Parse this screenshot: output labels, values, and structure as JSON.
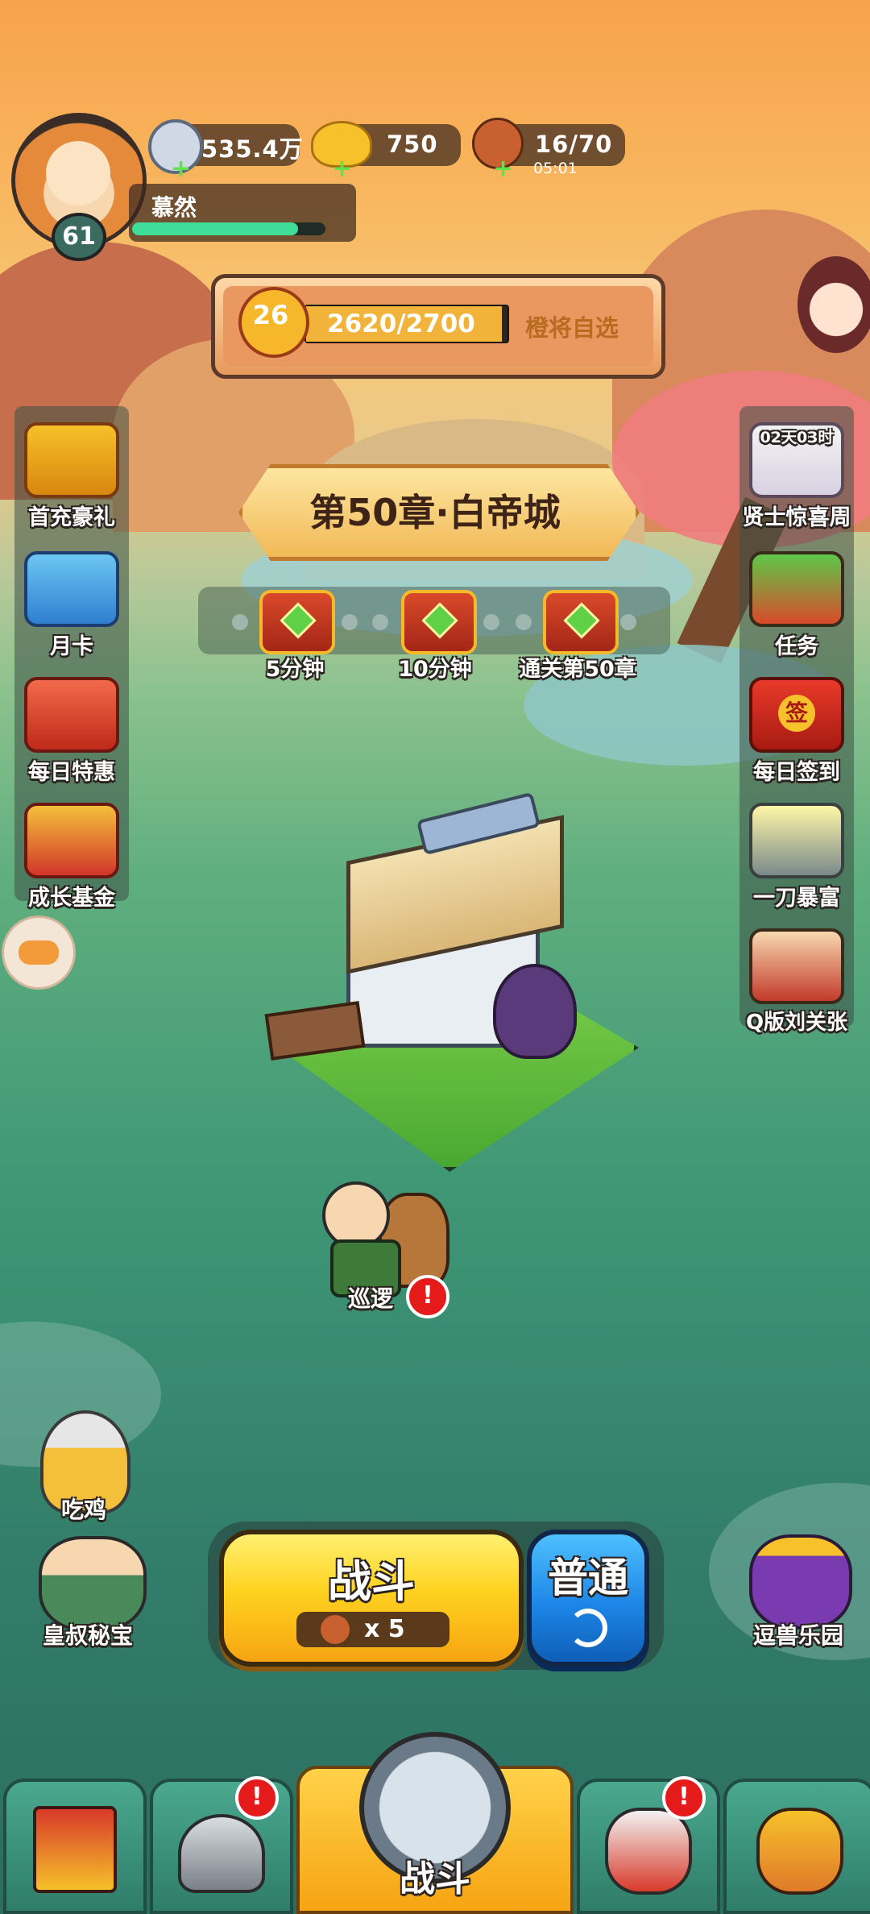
{
  "player": {
    "name": "慕然",
    "level": "61",
    "xp_fraction": 0.86
  },
  "resources": {
    "silver": "535.4万",
    "gold": "750",
    "stamina": "16/70",
    "stamina_timer": "05:01"
  },
  "rank_bar": {
    "level": "26",
    "progress": "2620/2700",
    "progress_fraction": 0.97,
    "button": "橙将自选"
  },
  "chapter": {
    "title": "第50章·白帝城"
  },
  "chest_rewards": [
    {
      "label": "5分钟"
    },
    {
      "label": "10分钟"
    },
    {
      "label": "通关第50章"
    }
  ],
  "left_menu": [
    {
      "label": "首充豪礼",
      "icon": "treasure-chest-icon"
    },
    {
      "label": "月卡",
      "icon": "calendar-icon"
    },
    {
      "label": "每日特惠",
      "icon": "gift-bag-icon"
    },
    {
      "label": "成长基金",
      "icon": "money-god-icon"
    }
  ],
  "right_menu": [
    {
      "label": "贤士惊喜周",
      "timer": "02天03时",
      "icon": "sage-girl-icon"
    },
    {
      "label": "任务",
      "icon": "scroll-icon"
    },
    {
      "label": "每日签到",
      "stamp": "签",
      "icon": "red-envelope-icon"
    },
    {
      "label": "一刀暴富",
      "icon": "sword-strike-icon"
    },
    {
      "label": "Q版刘关张",
      "icon": "three-heroes-icon"
    }
  ],
  "patrol": {
    "label": "巡逻",
    "alert": "!"
  },
  "left_bottom": [
    {
      "label": "吃鸡",
      "icon": "sunglasses-hero-icon"
    },
    {
      "label": "皇叔秘宝",
      "icon": "sleeping-scholar-icon"
    }
  ],
  "right_bottom": {
    "label": "逗兽乐园",
    "icon": "purple-beast-icon"
  },
  "battle": {
    "label": "战斗",
    "cost": "x 5"
  },
  "mode": {
    "label": "普通",
    "icon": "refresh-icon"
  },
  "bottom_nav": [
    {
      "name": "city",
      "icon": "city-gate-icon",
      "alert": ""
    },
    {
      "name": "equipment",
      "icon": "helmet-icon",
      "alert": "!"
    },
    {
      "name": "battle",
      "label": "战斗",
      "icon": "crossed-swords-icon",
      "alert": ""
    },
    {
      "name": "heroes",
      "icon": "rooster-hero-icon",
      "alert": "!"
    },
    {
      "name": "upgrade",
      "icon": "fist-upgrade-icon",
      "alert": ""
    }
  ],
  "colors": {
    "gold": "#f6c12a",
    "battle_yellow": "#ffd21f",
    "mode_blue": "#1d86e6",
    "alert_red": "#e51b1b",
    "xp_green": "#3fdc9a"
  }
}
